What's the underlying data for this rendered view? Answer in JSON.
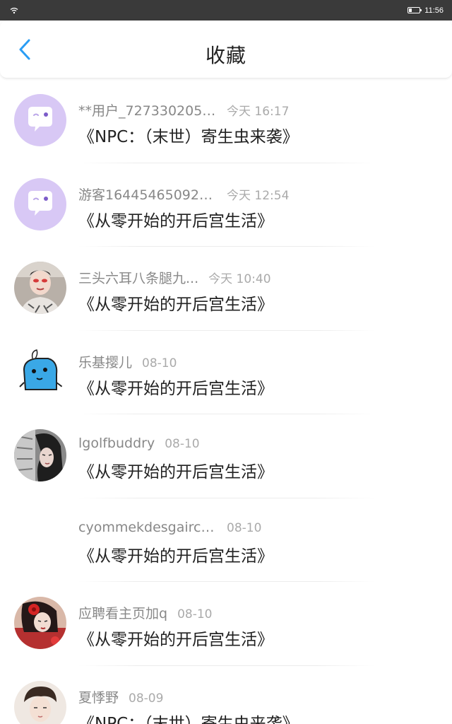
{
  "status_bar": {
    "time": "11:56",
    "wifi_icon": "wifi-icon",
    "battery_icon": "battery-icon"
  },
  "header": {
    "title": "收藏",
    "back_icon": "chevron-left-icon",
    "accent_color": "#2a9df4"
  },
  "favorites": [
    {
      "user": "**用户_7273302051..",
      "time": "今天 16:17",
      "book": "《NPC：（末世）寄生虫来袭》",
      "avatar": "default-chat-avatar",
      "avatar_color": "#d8c8f5"
    },
    {
      "user": "游客164454650920...",
      "time": "今天 12:54",
      "book": "《从零开始的开后宫生活》",
      "avatar": "default-chat-avatar",
      "avatar_color": "#d8c8f5"
    },
    {
      "user": "三头六耳八条腿九...",
      "time": "今天 10:40",
      "book": "《从零开始的开后宫生活》",
      "avatar": "photo-avatar-opera",
      "avatar_color": "#9a8f88"
    },
    {
      "user": "乐基撄儿",
      "time": "08-10",
      "book": "《从零开始的开后宫生活》",
      "avatar": "blue-cartoon-avatar",
      "avatar_color": "#3aa8e6"
    },
    {
      "user": "lgolfbuddry",
      "time": "08-10",
      "book": "《从零开始的开后宫生活》",
      "avatar": "photo-avatar-girl-window",
      "avatar_color": "#5a5a5a"
    },
    {
      "user": "cyommekdesgairco..",
      "time": "08-10",
      "book": "《从零开始的开后宫生活》",
      "avatar": "none",
      "avatar_color": "#ffffff"
    },
    {
      "user": "应聘看主页加q",
      "time": "08-10",
      "book": "《从零开始的开后宫生活》",
      "avatar": "photo-avatar-red-flower",
      "avatar_color": "#c43c3c"
    },
    {
      "user": "夏悸野",
      "time": "08-09",
      "book": "《NPC：（末世）寄生虫来袭》",
      "avatar": "photo-avatar-boy",
      "avatar_color": "#e8dcd4"
    }
  ]
}
